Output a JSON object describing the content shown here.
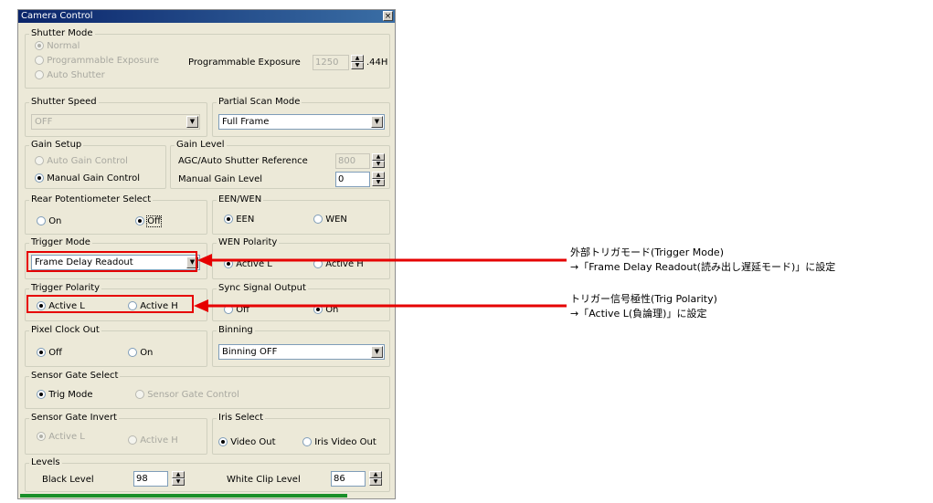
{
  "window": {
    "title": "Camera Control",
    "close_glyph": "×"
  },
  "shutter_mode": {
    "legend": "Shutter Mode",
    "options": [
      "Normal",
      "Programmable Exposure",
      "Auto Shutter"
    ],
    "prog_label": "Programmable Exposure",
    "prog_value": "1250",
    "prog_unit": ".44H"
  },
  "shutter_speed": {
    "legend": "Shutter Speed",
    "value": "OFF"
  },
  "partial_scan": {
    "legend": "Partial Scan Mode",
    "value": "Full Frame"
  },
  "gain_setup": {
    "legend": "Gain Setup",
    "options": [
      "Auto Gain Control",
      "Manual Gain Control"
    ]
  },
  "gain_level": {
    "legend": "Gain Level",
    "agc_label": "AGC/Auto Shutter Reference",
    "agc_value": "800",
    "manual_label": "Manual Gain Level",
    "manual_value": "0"
  },
  "rear_pot": {
    "legend": "Rear Potentiometer Select",
    "options": [
      "On",
      "Off"
    ]
  },
  "een_wen": {
    "legend": "EEN/WEN",
    "options": [
      "EEN",
      "WEN"
    ]
  },
  "trigger_mode": {
    "legend": "Trigger Mode",
    "value": "Frame Delay Readout"
  },
  "wen_polarity": {
    "legend": "WEN Polarity",
    "options": [
      "Active L",
      "Active H"
    ]
  },
  "trigger_polarity": {
    "legend": "Trigger Polarity",
    "options": [
      "Active L",
      "Active H"
    ]
  },
  "sync_output": {
    "legend": "Sync Signal Output",
    "options": [
      "Off",
      "On"
    ]
  },
  "pixel_clock": {
    "legend": "Pixel Clock Out",
    "options": [
      "Off",
      "On"
    ]
  },
  "binning": {
    "legend": "Binning",
    "value": "Binning OFF"
  },
  "sensor_gate": {
    "legend": "Sensor Gate Select",
    "options": [
      "Trig Mode",
      "Sensor Gate Control"
    ]
  },
  "sensor_gate_invert": {
    "legend": "Sensor Gate Invert",
    "options": [
      "Active L",
      "Active H"
    ]
  },
  "iris_select": {
    "legend": "Iris Select",
    "options": [
      "Video Out",
      "Iris Video Out"
    ]
  },
  "levels": {
    "legend": "Levels",
    "black_label": "Black Level",
    "black_value": "98",
    "white_label": "White Clip Level",
    "white_value": "86"
  },
  "annotations": {
    "trigger_mode_line1": "外部トリガモード(Trigger Mode)",
    "trigger_mode_line2": "→「Frame Delay Readout(読み出し遅延モード)」に設定",
    "trigger_polarity_line1": "トリガー信号極性(Trig Polarity)",
    "trigger_polarity_line2": "→「Active L(負論理)」に設定"
  },
  "colors": {
    "highlight": "#e60000",
    "titlebar": "#0a246a",
    "progress": "#1a8f2a"
  }
}
